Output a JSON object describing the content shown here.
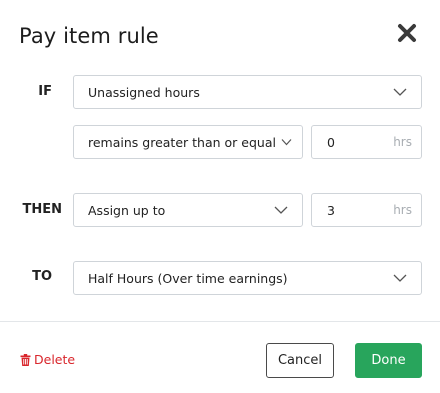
{
  "dialog": {
    "title": "Pay item rule",
    "close_icon": "close-icon"
  },
  "rule": {
    "if_label": "IF",
    "if_field": "Unassigned hours",
    "condition": "remains greater than or equal to",
    "condition_value": "0",
    "condition_unit": "hrs",
    "then_label": "THEN",
    "then_action": "Assign up to",
    "then_value": "3",
    "then_unit": "hrs",
    "to_label": "TO",
    "to_target": "Half Hours (Over time earnings)"
  },
  "footer": {
    "delete_label": "Delete",
    "delete_icon": "trash-icon",
    "cancel_label": "Cancel",
    "done_label": "Done"
  },
  "colors": {
    "delete": "#d9262c",
    "done_button": "#28a55c",
    "border": "#cfd4d9"
  }
}
